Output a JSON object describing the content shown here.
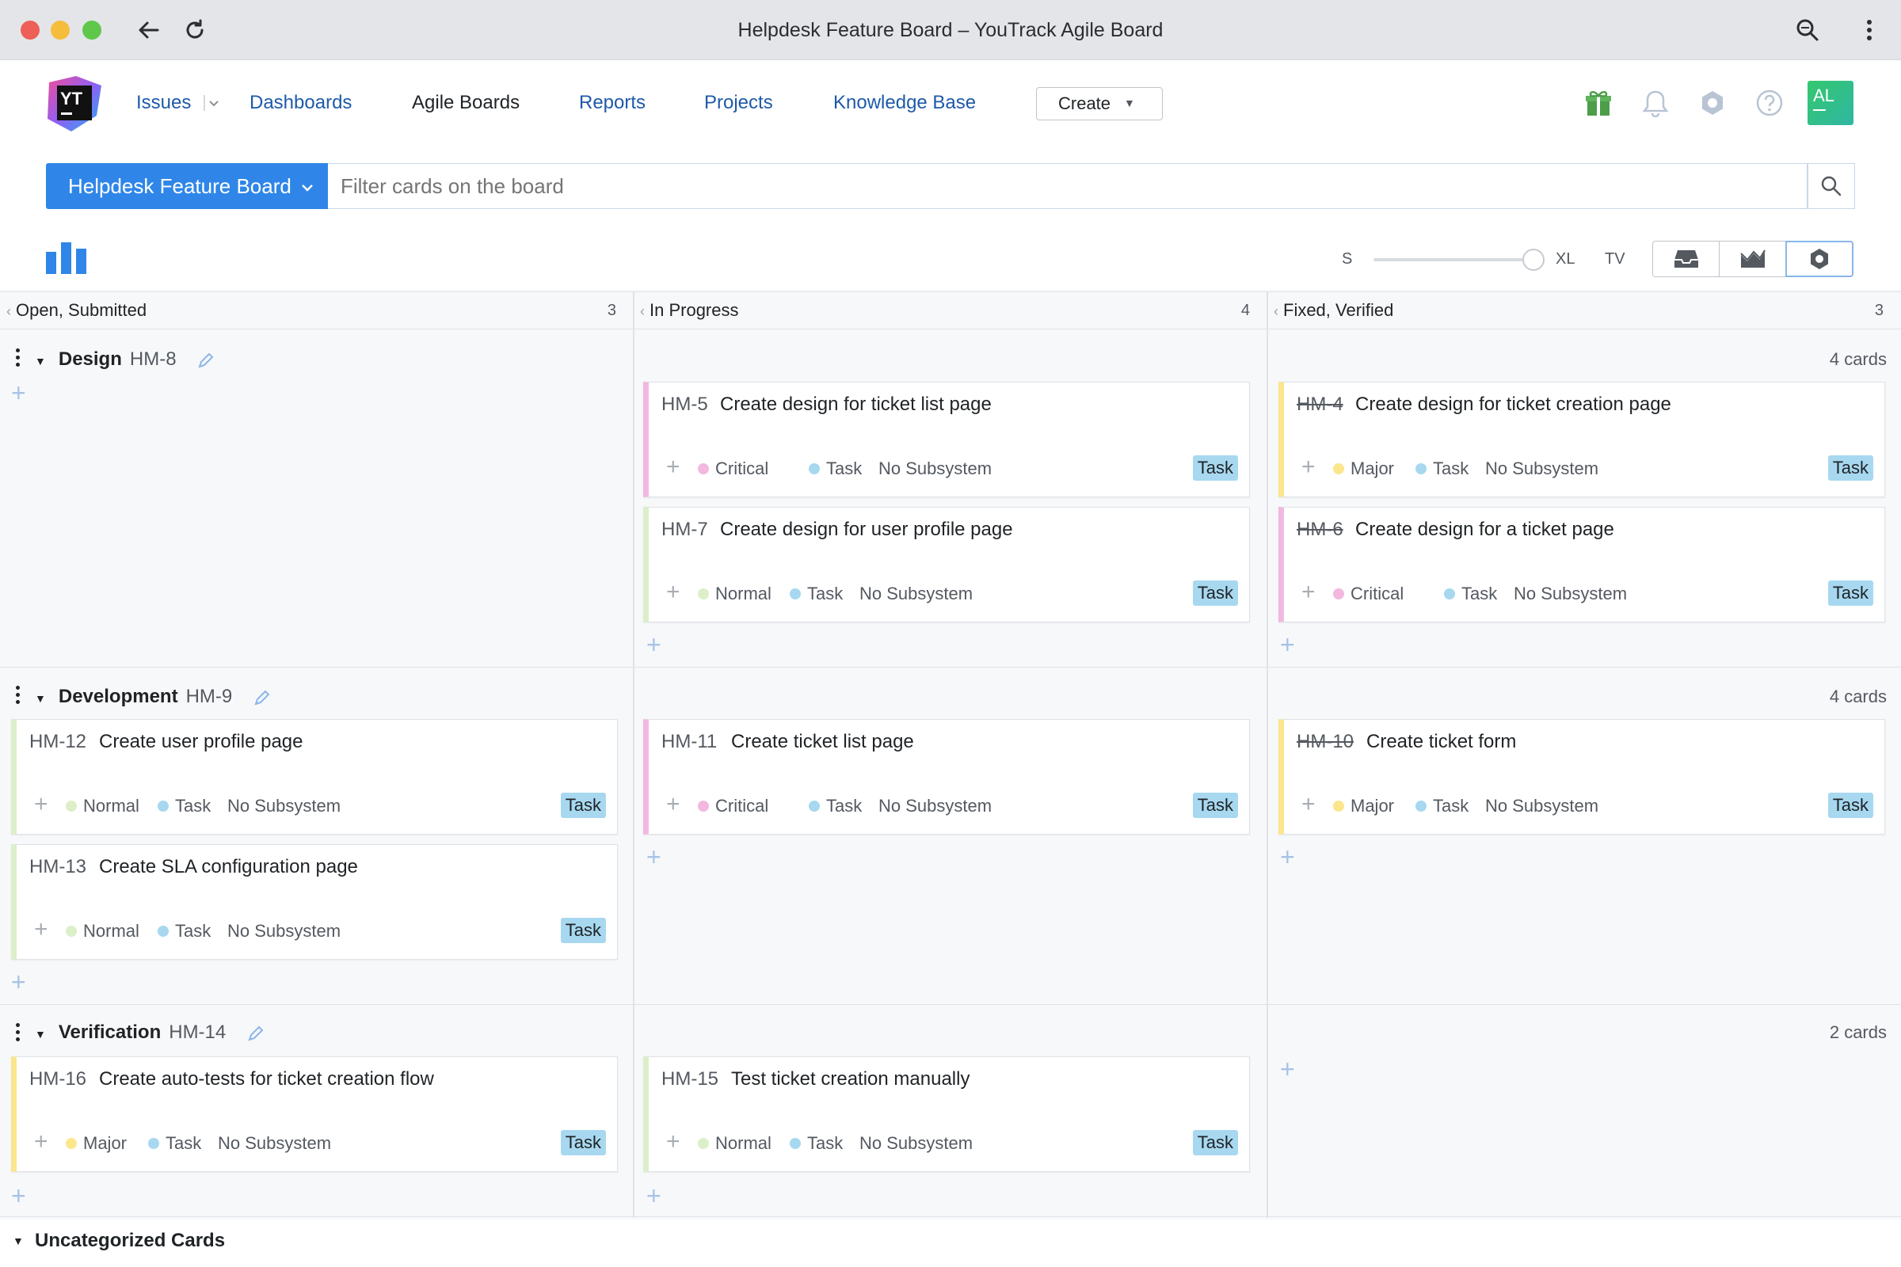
{
  "window": {
    "title": "Helpdesk Feature Board – YouTrack Agile Board"
  },
  "nav": {
    "issues": "Issues",
    "dashboards": "Dashboards",
    "agile_boards": "Agile Boards",
    "reports": "Reports",
    "projects": "Projects",
    "knowledge_base": "Knowledge Base",
    "create": "Create",
    "avatar_initials": "AL"
  },
  "toolbar": {
    "board_name": "Helpdesk Feature Board",
    "filter_placeholder": "Filter cards on the board",
    "size_small": "S",
    "size_large": "XL",
    "tv": "TV"
  },
  "columns": [
    {
      "name": "Open, Submitted",
      "count": "3"
    },
    {
      "name": "In Progress",
      "count": "4"
    },
    {
      "name": "Fixed, Verified",
      "count": "3"
    }
  ],
  "swimlanes": [
    {
      "title": "Design",
      "id": "HM-8",
      "count": "4 cards",
      "cards": [
        {
          "id": "HM-5",
          "title": "Create design for ticket list page",
          "priority": "Critical",
          "type": "Task",
          "subsystem": "No Subsystem",
          "tag": "Task",
          "color": "#f2b8df"
        },
        {
          "id": "HM-7",
          "title": "Create design for user profile page",
          "priority": "Normal",
          "type": "Task",
          "subsystem": "No Subsystem",
          "tag": "Task",
          "color": "#dcefc9"
        },
        {
          "id": "HM-4",
          "title": "Create design for ticket creation page",
          "priority": "Major",
          "type": "Task",
          "subsystem": "No Subsystem",
          "tag": "Task",
          "color": "#fbe68c"
        },
        {
          "id": "HM-6",
          "title": "Create design for a ticket page",
          "priority": "Critical",
          "type": "Task",
          "subsystem": "No Subsystem",
          "tag": "Task",
          "color": "#f2b8df"
        }
      ]
    },
    {
      "title": "Development",
      "id": "HM-9",
      "count": "4 cards",
      "cards": [
        {
          "id": "HM-12",
          "title": "Create user profile page",
          "priority": "Normal",
          "type": "Task",
          "subsystem": "No Subsystem",
          "tag": "Task",
          "color": "#dcefc9"
        },
        {
          "id": "HM-13",
          "title": "Create SLA configuration page",
          "priority": "Normal",
          "type": "Task",
          "subsystem": "No Subsystem",
          "tag": "Task",
          "color": "#dcefc9"
        },
        {
          "id": "HM-11",
          "title": "Create ticket list page",
          "priority": "Critical",
          "type": "Task",
          "subsystem": "No Subsystem",
          "tag": "Task",
          "color": "#f2b8df"
        },
        {
          "id": "HM-10",
          "title": "Create ticket form",
          "priority": "Major",
          "type": "Task",
          "subsystem": "No Subsystem",
          "tag": "Task",
          "color": "#fbe68c"
        }
      ]
    },
    {
      "title": "Verification",
      "id": "HM-14",
      "count": "2 cards",
      "cards": [
        {
          "id": "HM-16",
          "title": "Create auto-tests for ticket creation flow",
          "priority": "Major",
          "type": "Task",
          "subsystem": "No Subsystem",
          "tag": "Task",
          "color": "#fbe68c"
        },
        {
          "id": "HM-15",
          "title": "Test ticket creation manually",
          "priority": "Normal",
          "type": "Task",
          "subsystem": "No Subsystem",
          "tag": "Task",
          "color": "#dcefc9"
        }
      ]
    }
  ],
  "uncategorized": "Uncategorized Cards",
  "colors": {
    "accent": "#2f86e8",
    "type_dot": "#a7d8f0",
    "tag_bg": "#a7d8f0"
  }
}
